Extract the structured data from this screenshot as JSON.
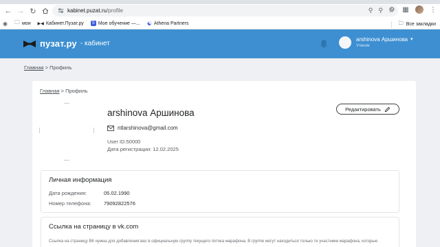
{
  "browser": {
    "url_host": "kabinet.puzat.ru",
    "url_path": "/profile",
    "bookmarks": [
      {
        "label": "мои",
        "icon": "folder-icon"
      },
      {
        "label": "Кабинет.Пузат.ру",
        "icon": "puzat-favicon"
      },
      {
        "label": "Мое обучение —...",
        "icon": "s-favicon"
      },
      {
        "label": "Athena Partners",
        "icon": "athena-favicon"
      }
    ],
    "bookmarks_right": "Все закладки"
  },
  "header": {
    "logo_text": "пузат.ру",
    "logo_sub": "- кабинет",
    "user_name": "arshinova Аршинова",
    "user_role": "Ученик"
  },
  "breadcrumb": {
    "home": "Главная",
    "sep": " > ",
    "current": "Профиль"
  },
  "profile": {
    "name": "arshinova Аршинова",
    "email": "ntlarshinova@gmail.com",
    "user_id": "User ID:50000",
    "registered": "Дата регистрации: 12.02.2025",
    "edit_label": "Редактировать"
  },
  "personal": {
    "title": "Личная информация",
    "birth_label": "Дата рождения:",
    "birth_value": "05.02.1990",
    "phone_label": "Номер телефона:",
    "phone_value": "79092822576"
  },
  "vk": {
    "title": "Ссылка на страницу в vk.com",
    "description": "Ссылка на страницу ВК нужна для добавления вас в официальную группу текущего потока марафона. В группе могут находиться только те участники марафона, которые"
  },
  "colors": {
    "header_bg": "#3d8fd1",
    "page_bg": "#eef0f3"
  }
}
